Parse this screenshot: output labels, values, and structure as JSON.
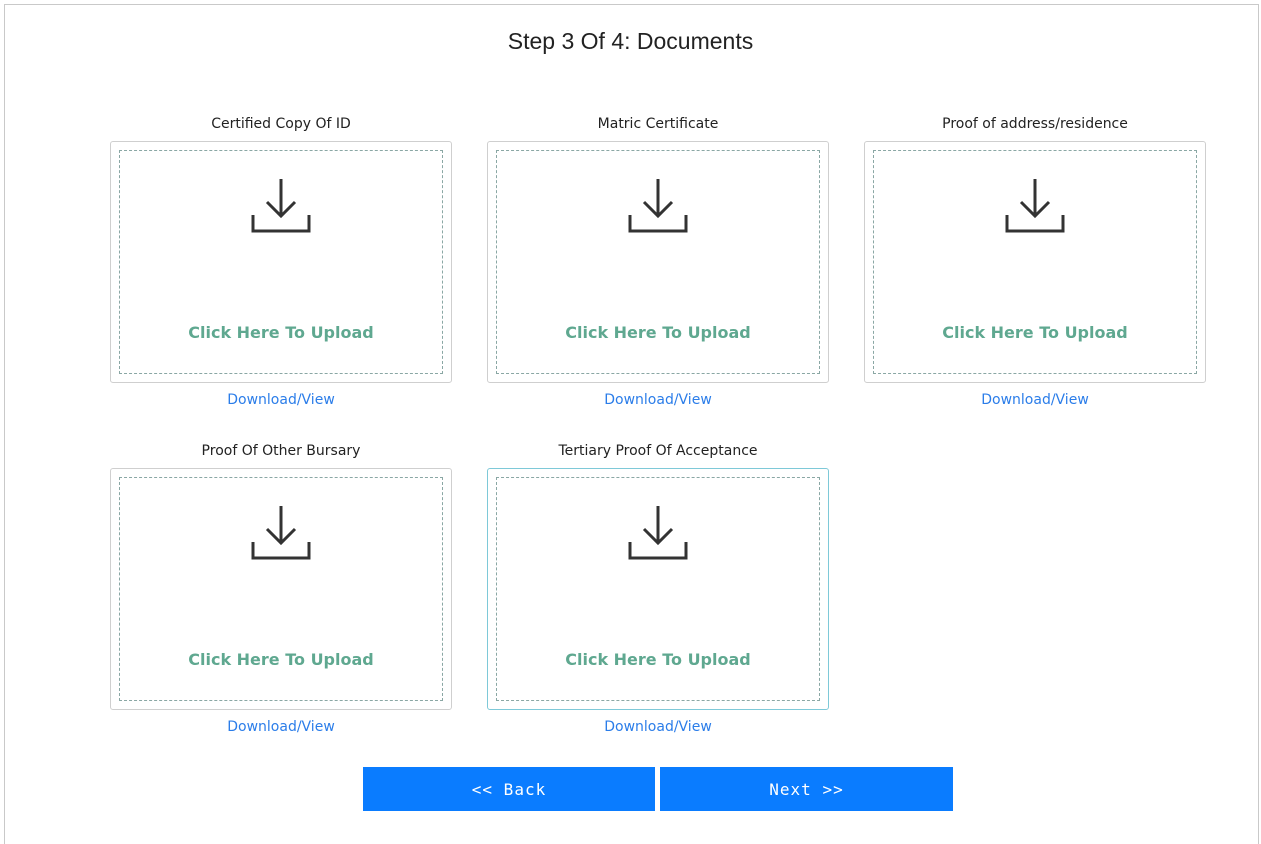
{
  "page": {
    "title": "Step 3 Of 4: Documents"
  },
  "documents": [
    {
      "label": "Certified Copy Of ID",
      "upload_text": "Click Here To Upload",
      "link_text": "Download/View"
    },
    {
      "label": "Matric Certificate",
      "upload_text": "Click Here To Upload",
      "link_text": "Download/View"
    },
    {
      "label": "Proof of address/residence",
      "upload_text": "Click Here To Upload",
      "link_text": "Download/View"
    },
    {
      "label": "Proof Of Other Bursary",
      "upload_text": "Click Here To Upload",
      "link_text": "Download/View"
    },
    {
      "label": "Tertiary Proof Of Acceptance",
      "upload_text": "Click Here To Upload",
      "link_text": "Download/View"
    }
  ],
  "nav": {
    "back_label": "<< Back",
    "next_label": "Next >>"
  },
  "colors": {
    "upload_text": "#5fa890",
    "link": "#2b7de9",
    "button": "#0a7cff",
    "active_border": "#7ec9d8"
  },
  "icons": {
    "upload": "download-tray-icon"
  }
}
